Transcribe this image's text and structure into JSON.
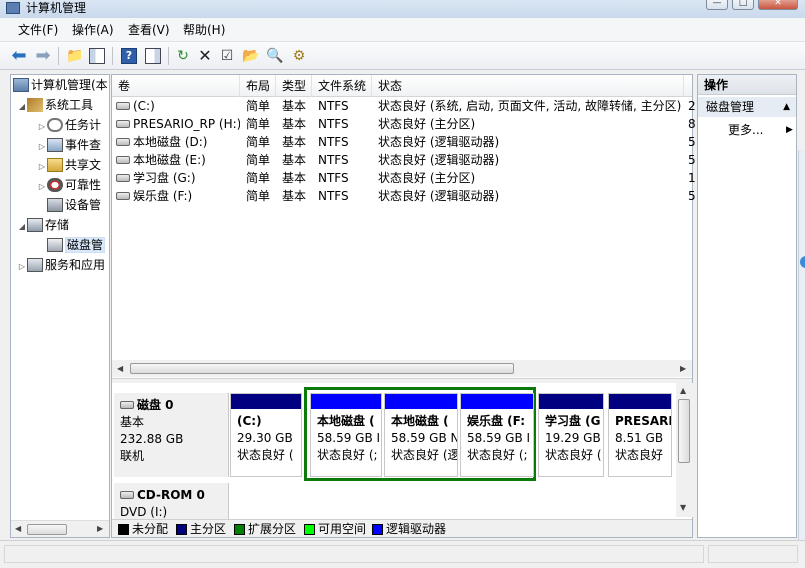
{
  "window": {
    "title": "计算机管理",
    "controls": [
      "—",
      "□",
      "✕"
    ]
  },
  "menu": [
    {
      "label": "文件(F)"
    },
    {
      "label": "操作(A)"
    },
    {
      "label": "查看(V)"
    },
    {
      "label": "帮助(H)"
    }
  ],
  "toolbar": [
    {
      "icon": "back-arrow-icon"
    },
    {
      "icon": "forward-arrow-icon"
    },
    {
      "icon": "up-folder-icon"
    },
    {
      "icon": "show-hide-tree-icon"
    },
    {
      "icon": "help-icon"
    },
    {
      "icon": "show-hide-action-pane-icon"
    },
    {
      "icon": "refresh-icon"
    },
    {
      "icon": "delete-icon"
    },
    {
      "icon": "properties-icon"
    },
    {
      "icon": "open-folder-icon"
    },
    {
      "icon": "search-icon"
    },
    {
      "icon": "disk-settings-icon"
    }
  ],
  "tree": [
    {
      "label": "计算机管理(本",
      "level": 0,
      "expander": "",
      "icon": "computer-management-icon"
    },
    {
      "label": "系统工具",
      "level": 1,
      "expander": "◢",
      "icon": "tools-icon"
    },
    {
      "label": "任务计",
      "level": 2,
      "expander": "▷",
      "icon": "clock-icon"
    },
    {
      "label": "事件查",
      "level": 2,
      "expander": "▷",
      "icon": "event-viewer-icon"
    },
    {
      "label": "共享文",
      "level": 2,
      "expander": "▷",
      "icon": "shared-folder-icon"
    },
    {
      "label": "可靠性",
      "level": 2,
      "expander": "▷",
      "icon": "performance-icon"
    },
    {
      "label": "设备管",
      "level": 2,
      "expander": "",
      "icon": "device-manager-icon"
    },
    {
      "label": "存储",
      "level": 1,
      "expander": "◢",
      "icon": "storage-icon"
    },
    {
      "label": "磁盘管",
      "level": 2,
      "expander": "",
      "icon": "disk-management-icon",
      "selected": true
    },
    {
      "label": "服务和应用",
      "level": 1,
      "expander": "▷",
      "icon": "services-icon"
    }
  ],
  "volumes": {
    "columns": [
      "卷",
      "布局",
      "类型",
      "文件系统",
      "状态"
    ],
    "rows": [
      {
        "name": "(C:)",
        "layout": "简单",
        "type": "基本",
        "fs": "NTFS",
        "status": "状态良好 (系统, 启动, 页面文件, 活动, 故障转储, 主分区)",
        "extra": "2"
      },
      {
        "name": "PRESARIO_RP (H:)",
        "layout": "简单",
        "type": "基本",
        "fs": "NTFS",
        "status": "状态良好 (主分区)",
        "extra": "8"
      },
      {
        "name": "本地磁盘 (D:)",
        "layout": "简单",
        "type": "基本",
        "fs": "NTFS",
        "status": "状态良好 (逻辑驱动器)",
        "extra": "5"
      },
      {
        "name": "本地磁盘 (E:)",
        "layout": "简单",
        "type": "基本",
        "fs": "NTFS",
        "status": "状态良好 (逻辑驱动器)",
        "extra": "5"
      },
      {
        "name": "学习盘 (G:)",
        "layout": "简单",
        "type": "基本",
        "fs": "NTFS",
        "status": "状态良好 (主分区)",
        "extra": "1"
      },
      {
        "name": "娱乐盘 (F:)",
        "layout": "简单",
        "type": "基本",
        "fs": "NTFS",
        "status": "状态良好 (逻辑驱动器)",
        "extra": "5"
      }
    ]
  },
  "disk0": {
    "name": "磁盘 0",
    "type": "基本",
    "size": "232.88 GB",
    "state": "联机",
    "partitions": [
      {
        "name": "(C:)",
        "size": "29.30 GB",
        "status": "状态良好 (",
        "bar": "#000080"
      },
      {
        "name": "本地磁盘  (",
        "size": "58.59 GB I",
        "status": "状态良好 (;",
        "bar": "#0000ff"
      },
      {
        "name": "本地磁盘  (",
        "size": "58.59 GB N",
        "status": "状态良好 (逻",
        "bar": "#0000ff"
      },
      {
        "name": "娱乐盘  (F:",
        "size": "58.59 GB I",
        "status": "状态良好 (;",
        "bar": "#0000ff"
      },
      {
        "name": "学习盘  (G",
        "size": "19.29 GB",
        "status": "状态良好 (",
        "bar": "#000080"
      },
      {
        "name": "PRESARI",
        "size": "8.51 GB",
        "status": "状态良好",
        "bar": "#000080"
      }
    ]
  },
  "cdrom0": {
    "name": "CD-ROM 0",
    "sub": "DVD (I:)"
  },
  "legend": [
    {
      "label": "未分配",
      "color": "#000000"
    },
    {
      "label": "主分区",
      "color": "#000080"
    },
    {
      "label": "扩展分区",
      "color": "#008000"
    },
    {
      "label": "可用空间",
      "color": "#00ff00"
    },
    {
      "label": "逻辑驱动器",
      "color": "#0000ff"
    }
  ],
  "actions": {
    "title": "操作",
    "section": "磁盘管理",
    "more": "更多..."
  }
}
